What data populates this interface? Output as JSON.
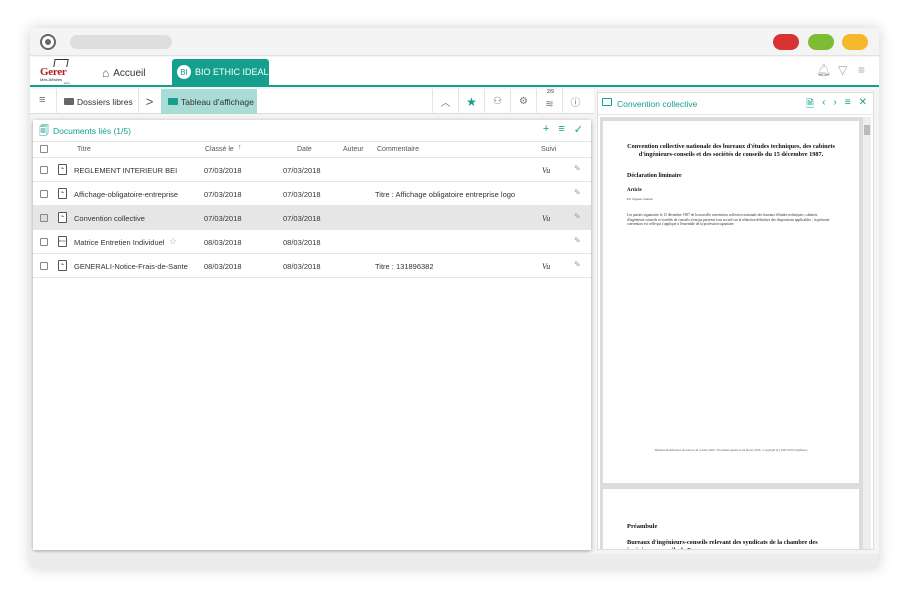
{
  "app": {
    "logo_main": "Gerer",
    "logo_sub": "Mes.Affaires",
    "logo_com": ".com",
    "home_tab": "Accueil",
    "active_tab": "BIO ETHIC IDEAL",
    "active_tab_icon": "BI"
  },
  "breadcrumb": {
    "item1": "Dossiers libres",
    "item2": "Tableau d'affichage",
    "badge": "2/9"
  },
  "documents": {
    "title": "Documents liés (1/5)",
    "columns": {
      "titre": "Titre",
      "classe_le": "Classé le",
      "date": "Date",
      "auteur": "Auteur",
      "commentaire": "Commentaire",
      "suivi": "Suivi"
    },
    "rows": [
      {
        "titre": "REGLEMENT INTERIEUR BEI",
        "classe": "07/03/2018",
        "date": "07/03/2018",
        "commentaire": "",
        "suivi": "Vu",
        "icon": "pdf-icon",
        "glyph": "⌁"
      },
      {
        "titre": "Affichage-obligatoire-entreprise",
        "classe": "07/03/2018",
        "date": "07/03/2018",
        "commentaire": "Titre : Affichage obligatoire entreprise logo",
        "suivi": "",
        "icon": "pdf-icon",
        "glyph": "⌁"
      },
      {
        "titre": "Convention collective",
        "classe": "07/03/2018",
        "date": "07/03/2018",
        "commentaire": "",
        "suivi": "Vu",
        "icon": "pdf-icon",
        "glyph": "⌁"
      },
      {
        "titre": "Matrice Entretien Individuel",
        "classe": "08/03/2018",
        "date": "08/03/2018",
        "commentaire": "",
        "suivi": "",
        "icon": "doc-icon",
        "glyph": "DOC"
      },
      {
        "titre": "GENERALI-Notice-Frais-de-Sante",
        "classe": "08/03/2018",
        "date": "08/03/2018",
        "commentaire": "Titre : 131896382",
        "suivi": "Vu",
        "icon": "pdf-icon",
        "glyph": "⌁"
      }
    ]
  },
  "viewer": {
    "title": "Convention collective",
    "page1_title": "Convention collective nationale des bureaux d'études techniques, des cabinets d'ingénieurs-conseils et des sociétés de conseils du 15 décembre 1987.",
    "page1_h1": "Déclaration liminaire",
    "page1_h2": "Article",
    "page1_small": "En vigueur étendu",
    "page1_para": "Les parties signataires le 15 décembre 1987 de la nouvelle convention collective nationale des bureaux d'études techniques, cabinets d'ingénieurs-conseils et sociétés de conseils n'ont pu parvenir à un accord sur la rédaction définitive des dispositions applicables ; la présente convention est celle qui s'applique à l'ensemble de la profession signataire.",
    "page1_footer": "Dernière modification du texte le 30 octobre 2009 - Document généré le 24 février 2016 - Copyright (C) 2007-2016 Legifrance",
    "page2_h": "Préambule",
    "page2_b": "Bureaux d'ingénieurs-conseils relevant des syndicats de la chambre des ingénieurs-conseils de France"
  },
  "colors": {
    "accent": "#14a08c",
    "selected_crumb": "#a9dcd5",
    "dot_red": "#d93232",
    "dot_green": "#7dbd34",
    "dot_yellow": "#f5b82a"
  }
}
